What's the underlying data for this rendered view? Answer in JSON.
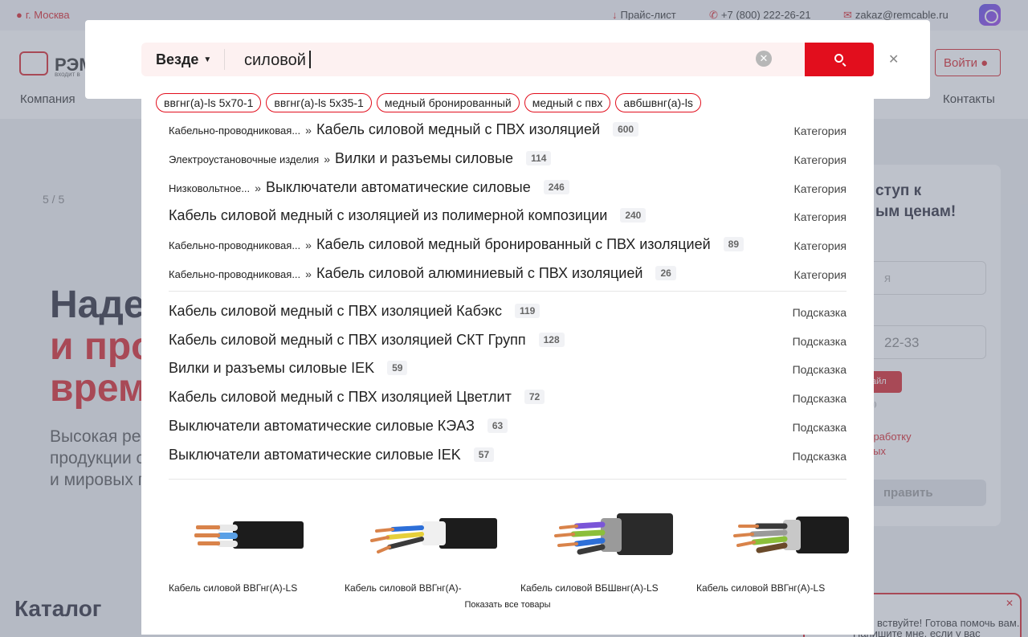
{
  "topbar": {
    "city": "г. Москва",
    "price_list": "Прайс-лист",
    "phone": "+7 (800) 222-26-21",
    "email": "zakaz@remcable.ru"
  },
  "header": {
    "logo_text": "РЭМ",
    "logo_sub": "входит в",
    "login": "Войти",
    "nav_left": "Компания",
    "nav_right": "Контакты"
  },
  "hero": {
    "counter": "5 / 5",
    "line1": "Надеж",
    "line2": "и прод",
    "line3": "время",
    "text1": "Высокая реп",
    "text2": "продукции с",
    "text3": "и мировых п"
  },
  "catalog_title": "Каталог",
  "form": {
    "heading1": "ступ к",
    "heading2": "ым ценам!",
    "name_placeholder": "я",
    "phone_placeholder": "22-33",
    "file_label": "айл",
    "note": "ия)",
    "agree1": "бработку",
    "agree2": "ных",
    "send": "править"
  },
  "chat": {
    "line1": "вствуйте! Готова помочь вам.",
    "line2": "Напишите мне, если у вас появятся"
  },
  "search": {
    "scope": "Везде",
    "query": "силовой",
    "chips": [
      "ввгнг(а)-ls 5х70-1",
      "ввгнг(а)-ls 5х35-1",
      "медный бронированный",
      "медный с пвх",
      "авбшвнг(а)-ls"
    ],
    "categories": [
      {
        "path": "Кабельно-проводниковая...",
        "name": "Кабель силовой медный с ПВХ изоляцией",
        "count": "600",
        "type": "Категория"
      },
      {
        "path": "Электроустановочные изделия",
        "name": "Вилки и разъемы силовые",
        "count": "114",
        "type": "Категория"
      },
      {
        "path": "Низковольтное...",
        "name": "Выключатели автоматические силовые",
        "count": "246",
        "type": "Категория"
      },
      {
        "path": "",
        "name": "Кабель силовой медный с изоляцией из полимерной композиции",
        "count": "240",
        "type": "Категория"
      },
      {
        "path": "Кабельно-проводниковая...",
        "name": "Кабель силовой медный бронированный с ПВХ изоляцией",
        "count": "89",
        "type": "Категория"
      },
      {
        "path": "Кабельно-проводниковая...",
        "name": "Кабель силовой алюминиевый с ПВХ изоляцией",
        "count": "26",
        "type": "Категория"
      }
    ],
    "hints": [
      {
        "name": "Кабель силовой медный с ПВХ изоляцией Кабэкс",
        "count": "119",
        "type": "Подсказка"
      },
      {
        "name": "Кабель силовой медный с ПВХ изоляцией СКТ Групп",
        "count": "128",
        "type": "Подсказка"
      },
      {
        "name": "Вилки и разъемы силовые IEK",
        "count": "59",
        "type": "Подсказка"
      },
      {
        "name": "Кабель силовой медный с ПВХ изоляцией Цветлит",
        "count": "72",
        "type": "Подсказка"
      },
      {
        "name": "Выключатели автоматические силовые КЭАЗ",
        "count": "63",
        "type": "Подсказка"
      },
      {
        "name": "Выключатели автоматические силовые IEK",
        "count": "57",
        "type": "Подсказка"
      }
    ],
    "products": [
      {
        "name": "Кабель силовой ВВГнг(А)-LS"
      },
      {
        "name": "Кабель силовой ВВГнг(А)-"
      },
      {
        "name": "Кабель силовой ВБШвнг(А)-LS"
      },
      {
        "name": "Кабель силовой ВВГнг(А)-LS"
      }
    ],
    "show_all": "Показать все товары"
  },
  "colors": {
    "accent": "#e20e1d",
    "chip_border": "#e20e1d",
    "search_bg": "#fdf1f1"
  }
}
